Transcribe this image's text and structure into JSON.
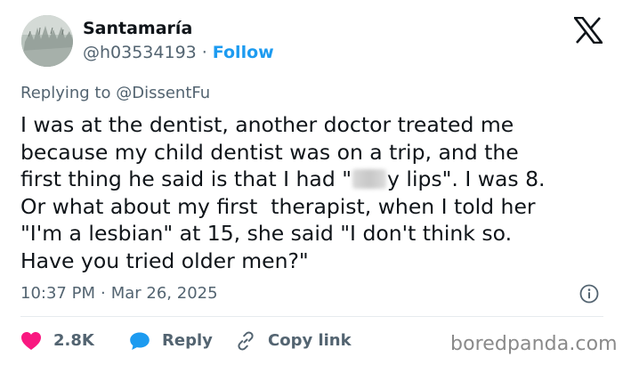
{
  "author": {
    "name": "Santamaría",
    "handle": "@h03534193",
    "separator": "·",
    "follow_label": "Follow"
  },
  "replying": {
    "prefix": "Replying to",
    "handle": "@DissentFu"
  },
  "body": {
    "line1": "I was at the dentist, another doctor treated me",
    "line2": "because my child dentist was on a trip, and the",
    "line3_before": "first thing he said is that I had \"",
    "line3_after": "y lips\". I was 8.",
    "line4": "Or what about my first  therapist, when I told her",
    "line5": "\"I'm a lesbian\" at 15, she said \"I don't think so.",
    "line6": "Have you tried older men?\""
  },
  "meta": {
    "time": "10:37 PM",
    "separator": "·",
    "date": "Mar 26, 2025"
  },
  "actions": {
    "likes": "2.8K",
    "reply_label": "Reply",
    "copy_label": "Copy link"
  },
  "watermark": "boredpanda.com",
  "icons": {
    "platform": "x-logo-icon",
    "info": "info-icon",
    "like": "heart-icon",
    "reply": "speech-bubble-icon",
    "copy": "link-icon"
  },
  "colors": {
    "text": "#0f1419",
    "secondary": "#536471",
    "accent": "#1d9bf0",
    "like": "#f91880",
    "divider": "#e6ebee"
  }
}
